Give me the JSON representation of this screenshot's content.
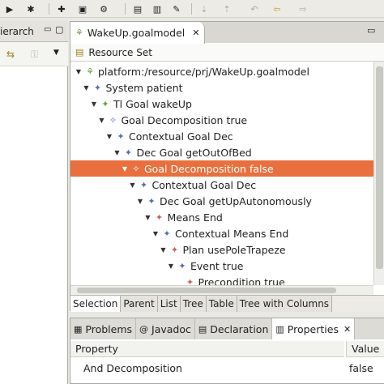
{
  "toolbar": {
    "icons": [
      "run-icon",
      "debug-icon",
      "new-icon",
      "open-icon",
      "build-icon",
      "folder-icon",
      "folder-open-icon",
      "wand-icon",
      "pin-icon",
      "nav-icon",
      "annotation-icon",
      "back-icon",
      "forward-icon"
    ]
  },
  "left_panel": {
    "tab_label": "ierarch"
  },
  "editor": {
    "tab_label": "WakeUp.goalmodel",
    "resource_set": "Resource Set",
    "tree": [
      {
        "label": "platform:/resource/prj/WakeUp.goalmodel",
        "depth": 0,
        "icon": "file-icon"
      },
      {
        "label": "System patient",
        "depth": 1,
        "icon": "system-icon"
      },
      {
        "label": "Tl Goal wakeUp",
        "depth": 2,
        "icon": "goal-icon"
      },
      {
        "label": "Goal Decomposition true",
        "depth": 3,
        "icon": "decomposition-icon"
      },
      {
        "label": "Contextual Goal Dec",
        "depth": 4,
        "icon": "contextual-goal-icon"
      },
      {
        "label": "Dec Goal getOutOfBed",
        "depth": 5,
        "icon": "dec-goal-icon"
      },
      {
        "label": "Goal Decomposition false",
        "depth": 6,
        "icon": "decomposition-icon",
        "selected": true
      },
      {
        "label": "Contextual Goal Dec",
        "depth": 7,
        "icon": "contextual-goal-icon"
      },
      {
        "label": "Dec Goal getUpAutonomously",
        "depth": 8,
        "icon": "dec-goal-icon"
      },
      {
        "label": "Means End",
        "depth": 9,
        "icon": "means-end-icon"
      },
      {
        "label": "Contextual Means End",
        "depth": 10,
        "icon": "contextual-means-end-icon"
      },
      {
        "label": "Plan usePoleTrapeze",
        "depth": 11,
        "icon": "plan-icon"
      },
      {
        "label": "Event true",
        "depth": 12,
        "icon": "event-icon"
      },
      {
        "label": "Precondition true",
        "depth": 13,
        "icon": "precondition-icon"
      }
    ],
    "page_tabs": [
      "Selection",
      "Parent",
      "List",
      "Tree",
      "Table",
      "Tree with Columns"
    ]
  },
  "bottom_panel": {
    "tabs": [
      {
        "label": "Problems",
        "icon": "problems-icon"
      },
      {
        "label": "Javadoc",
        "icon": "javadoc-icon"
      },
      {
        "label": "Declaration",
        "icon": "declaration-icon"
      },
      {
        "label": "Properties",
        "icon": "properties-icon",
        "active": true
      }
    ],
    "columns": [
      "Property",
      "Value"
    ],
    "rows": [
      {
        "property": "And Decomposition",
        "value": "false"
      }
    ]
  }
}
